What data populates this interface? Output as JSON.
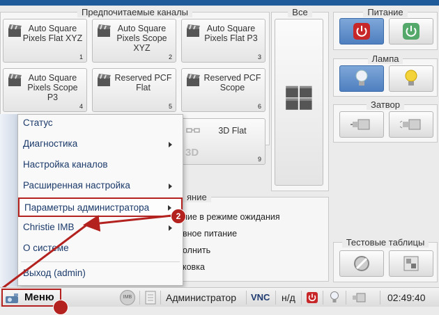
{
  "panels": {
    "channels_title": "Предпочитаемые каналы",
    "all_title": "Все",
    "power_title": "Питание",
    "lamp_title": "Лампа",
    "shutter_title": "Затвор",
    "test_title": "Тестовые таблицы",
    "options_title": "яние"
  },
  "channels": [
    {
      "label": "Auto Square Pixels Flat XYZ",
      "num": "1"
    },
    {
      "label": "Auto Square Pixels Scope XYZ",
      "num": "2"
    },
    {
      "label": "Auto Square Pixels Flat P3",
      "num": "3"
    },
    {
      "label": "Auto Square Pixels Scope P3",
      "num": "4"
    },
    {
      "label": "Reserved PCF Flat",
      "num": "5"
    },
    {
      "label": "Reserved PCF Scope",
      "num": "6"
    },
    {
      "label": "3D Flat",
      "num": "9"
    }
  ],
  "options": [
    "ние в режиме ожидания",
    "вное питание",
    "олнить",
    "ковка"
  ],
  "menu": {
    "items": [
      {
        "label": "Статус",
        "submenu": false
      },
      {
        "label": "Диагностика",
        "submenu": true
      },
      {
        "label": "Настройка каналов",
        "submenu": false
      },
      {
        "label": "Расширенная настройка",
        "submenu": true
      },
      {
        "label": "Параметры администратора",
        "submenu": true
      },
      {
        "label": "Christie IMB",
        "submenu": true
      },
      {
        "label": "О системе",
        "submenu": false
      },
      {
        "label": "Выход (admin)",
        "submenu": false
      }
    ]
  },
  "callouts": [
    "2"
  ],
  "statusbar": {
    "menu_label": "Меню",
    "imb_label": "IMB",
    "user": "Администратор",
    "vnc": "VNC",
    "na": "н/д",
    "time": "02:49:40"
  },
  "colors": {
    "accent": "#b3221f",
    "power_red": "#c8272a",
    "power_green": "#53a86a",
    "active_blue": "#4f7fbf"
  }
}
